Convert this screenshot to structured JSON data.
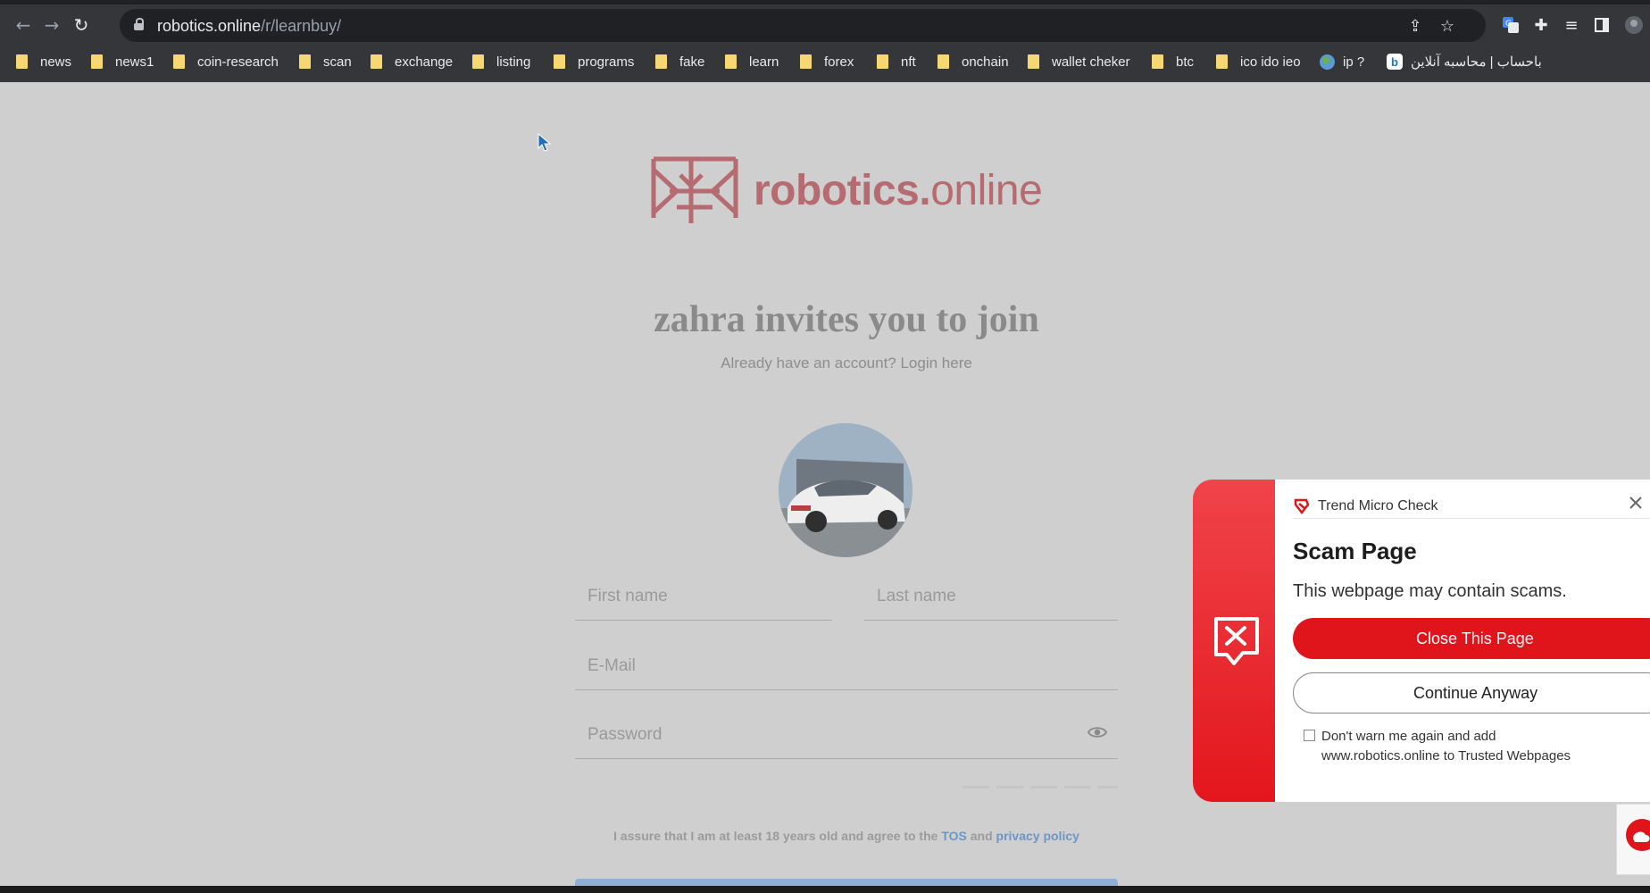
{
  "browser": {
    "url_host": "robotics.online",
    "url_path": "/r/learnbuy/",
    "bookmarks": [
      {
        "label": "news",
        "icon": "folder-icon"
      },
      {
        "label": "news1",
        "icon": "folder-icon"
      },
      {
        "label": "coin-research",
        "icon": "folder-icon"
      },
      {
        "label": "scan",
        "icon": "folder-icon"
      },
      {
        "label": "exchange",
        "icon": "folder-icon"
      },
      {
        "label": "listing",
        "icon": "folder-icon"
      },
      {
        "label": "programs",
        "icon": "folder-icon"
      },
      {
        "label": "fake",
        "icon": "folder-icon"
      },
      {
        "label": "learn",
        "icon": "folder-icon"
      },
      {
        "label": "forex",
        "icon": "folder-icon"
      },
      {
        "label": "nft",
        "icon": "folder-icon"
      },
      {
        "label": "onchain",
        "icon": "folder-icon"
      },
      {
        "label": "wallet cheker",
        "icon": "folder-icon"
      },
      {
        "label": "btc",
        "icon": "folder-icon"
      },
      {
        "label": "ico ido ieo",
        "icon": "folder-icon"
      },
      {
        "label": "ip ?",
        "icon": "globe-icon"
      },
      {
        "label": "باحساب | محاسبه آنلاین",
        "icon": "b-favicon",
        "favicon_letter": "b"
      }
    ]
  },
  "page": {
    "logo_text_bold": "robotics.",
    "logo_text_light": "online",
    "headline": "zahra invites you to join",
    "login_prompt": "Already have an account? Login here",
    "form": {
      "first_name_placeholder": "First name",
      "last_name_placeholder": "Last name",
      "email_placeholder": "E-Mail",
      "password_placeholder": "Password"
    },
    "consent_prefix": "I assure that I am at least 18 years old and agree to the",
    "consent_tos": "TOS",
    "consent_and": "and",
    "consent_privacy": "privacy policy"
  },
  "popup": {
    "brand": "Trend Micro Check",
    "title": "Scam Page",
    "description": "This webpage may contain scams.",
    "close_button": "Close This Page",
    "continue_button": "Continue Anyway",
    "checkbox_label": "Don't warn me again and add www.robotics.online to Trusted Webpages",
    "colors": {
      "accent": "#e0151c",
      "panel_gradient_top": "#f0444a"
    }
  },
  "colors": {
    "page_background": "#cfcfcf",
    "logo": "#b56b70",
    "browser_chrome": "#35363a"
  }
}
